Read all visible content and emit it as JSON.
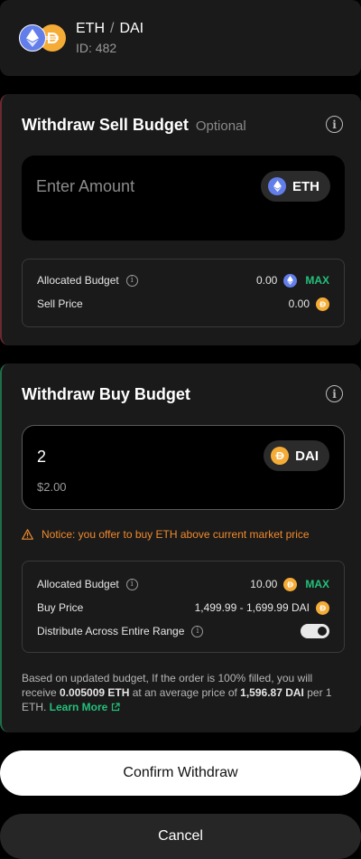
{
  "header": {
    "base_token": "ETH",
    "separator": "/",
    "quote_token": "DAI",
    "id_label": "ID: 482"
  },
  "sell": {
    "title": "Withdraw Sell Budget",
    "optional": "Optional",
    "amount_placeholder": "Enter Amount",
    "token": "ETH",
    "allocated_label": "Allocated Budget",
    "allocated_value": "0.00",
    "max_label": "MAX",
    "price_label": "Sell Price",
    "price_value": "0.00"
  },
  "buy": {
    "title": "Withdraw Buy Budget",
    "amount_value": "2",
    "amount_usd": "$2.00",
    "token": "DAI",
    "notice": "Notice: you offer to buy ETH above current market price",
    "allocated_label": "Allocated Budget",
    "allocated_value": "10.00",
    "max_label": "MAX",
    "price_label": "Buy Price",
    "price_value": "1,499.99 - 1,699.99 DAI",
    "distribute_label": "Distribute Across Entire Range",
    "distribute_on": true,
    "summary": {
      "part1": "Based on updated budget, If the order is 100% filled, you will receive ",
      "receive_amount": "0.005009 ETH",
      "part2": " at an average price of ",
      "avg_price": "1,596.87 DAI",
      "part3": " per 1 ETH. ",
      "learn_more": "Learn More"
    }
  },
  "actions": {
    "confirm_label": "Confirm Withdraw",
    "cancel_label": "Cancel"
  },
  "colors": {
    "eth": "#627eea",
    "dai": "#f5ac37",
    "accent_green": "#23c07a",
    "warning_orange": "#f08a2c"
  }
}
